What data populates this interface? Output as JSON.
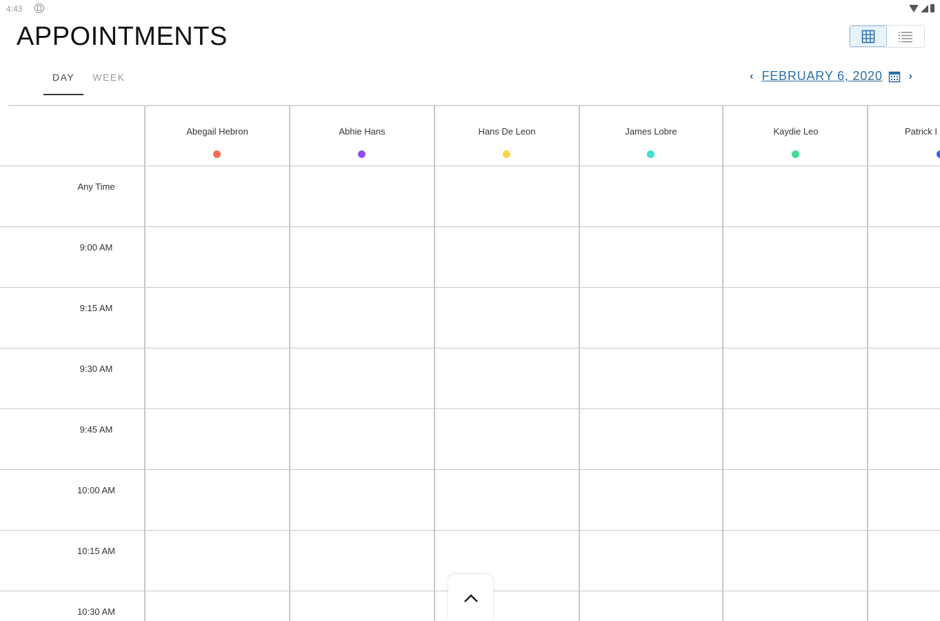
{
  "status_bar": {
    "time": "4:43",
    "app_icon": "notification-icon",
    "icons": [
      "wifi-icon",
      "signal-icon",
      "battery-icon"
    ]
  },
  "header": {
    "title": "APPOINTMENTS"
  },
  "view_toggle": {
    "options": [
      "grid-view-icon",
      "list-view-icon"
    ],
    "active": "grid-view-icon"
  },
  "tabs": [
    {
      "label": "DAY",
      "active": true
    },
    {
      "label": "WEEK",
      "active": false
    }
  ],
  "date_nav": {
    "date": "FEBRUARY 6, 2020",
    "prev_icon": "chevron-left-icon",
    "next_icon": "chevron-right-icon",
    "calendar_icon": "calendar-icon"
  },
  "staff": [
    {
      "name": "Abegail Hebron",
      "color": "#f26d54"
    },
    {
      "name": "Abhie Hans",
      "color": "#8e4ff0"
    },
    {
      "name": "Hans De Leon",
      "color": "#f5d44a"
    },
    {
      "name": "James Lobre",
      "color": "#3fe0d0"
    },
    {
      "name": "Kaydie Leo",
      "color": "#3ddc97"
    },
    {
      "name": "Patrick I",
      "color": "#3d5cf0"
    }
  ],
  "time_slots": [
    "Any Time",
    "9:00 AM",
    "9:15 AM",
    "9:30 AM",
    "9:45 AM",
    "10:00 AM",
    "10:15 AM",
    "10:30 AM"
  ],
  "colors": {
    "accent": "#2a6fa8",
    "grid_line": "#c8c8c8"
  },
  "scroll_button": {
    "icon": "chevron-up-icon"
  }
}
